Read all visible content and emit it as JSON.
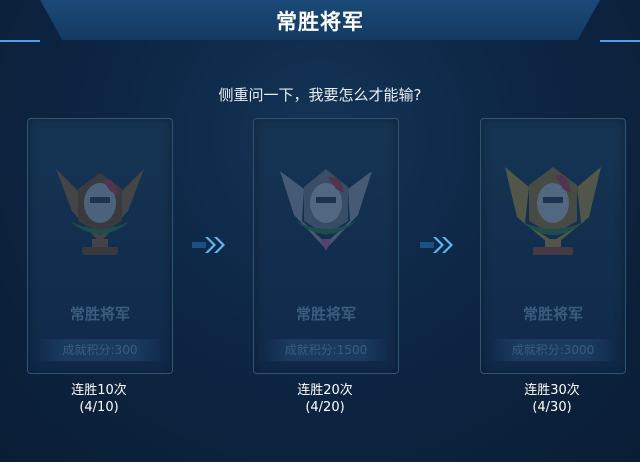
{
  "header": {
    "title": "常胜将军"
  },
  "question": "侧重问一下，我要怎么才能输?",
  "cards": [
    {
      "name": "常胜将军",
      "points": "成就积分:300",
      "caption_line1": "连胜10次",
      "caption_line2": "(4/10)",
      "tier": "bronze"
    },
    {
      "name": "常胜将军",
      "points": "成就积分:1500",
      "caption_line1": "连胜20次",
      "caption_line2": "(4/20)",
      "tier": "silver"
    },
    {
      "name": "常胜将军",
      "points": "成就积分:3000",
      "caption_line1": "连胜30次",
      "caption_line2": "(4/30)",
      "tier": "gold"
    }
  ],
  "icons": {
    "emblem": "helmet-trophy-icon",
    "arrow": "double-chevron-right-icon"
  },
  "colors": {
    "background": "#0d2644",
    "accent": "#4aa3e8",
    "bronze": "#8a5f3a",
    "silver": "#8a94a6",
    "gold": "#a98a44"
  }
}
